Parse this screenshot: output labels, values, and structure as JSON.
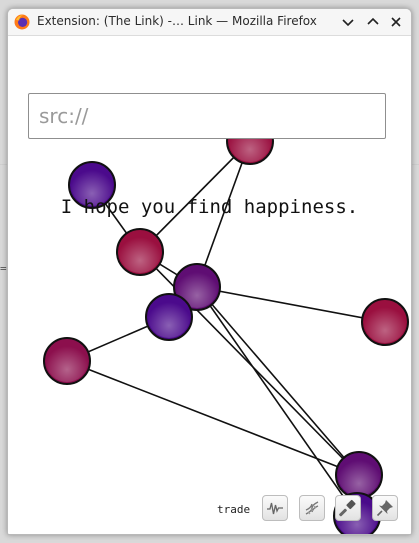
{
  "window": {
    "title": "Extension: (The Link) -… Link — Mozilla Firefox"
  },
  "search": {
    "placeholder": "src://",
    "value": ""
  },
  "message": "I hope you find happiness.",
  "toolbar": {
    "trade_label": "trade",
    "buttons": [
      {
        "name": "waveform-button",
        "icon": "waveform-icon"
      },
      {
        "name": "dna-button",
        "icon": "dna-icon"
      },
      {
        "name": "hammer-button",
        "icon": "hammer-icon"
      },
      {
        "name": "pin-button",
        "icon": "pushpin-icon"
      }
    ]
  },
  "graph": {
    "nodes": [
      {
        "id": "n1",
        "color": "#9a0f3f"
      },
      {
        "id": "n2",
        "color": "#4b0a8c"
      },
      {
        "id": "n3",
        "color": "#9a0f3f"
      },
      {
        "id": "n4",
        "color": "#5f0d73"
      },
      {
        "id": "n5",
        "color": "#4b0a8c"
      },
      {
        "id": "n6",
        "color": "#9a0f3f"
      },
      {
        "id": "n7",
        "color": "#8c0f4d"
      },
      {
        "id": "n8",
        "color": "#5f0d73"
      },
      {
        "id": "n9",
        "color": "#4a0a8a"
      }
    ],
    "edges": [
      [
        "n1",
        "n3"
      ],
      [
        "n1",
        "n4"
      ],
      [
        "n2",
        "n3"
      ],
      [
        "n3",
        "n4"
      ],
      [
        "n3",
        "n8"
      ],
      [
        "n4",
        "n6"
      ],
      [
        "n4",
        "n5"
      ],
      [
        "n5",
        "n7"
      ],
      [
        "n4",
        "n8"
      ],
      [
        "n4",
        "n9"
      ],
      [
        "n7",
        "n8"
      ]
    ]
  }
}
